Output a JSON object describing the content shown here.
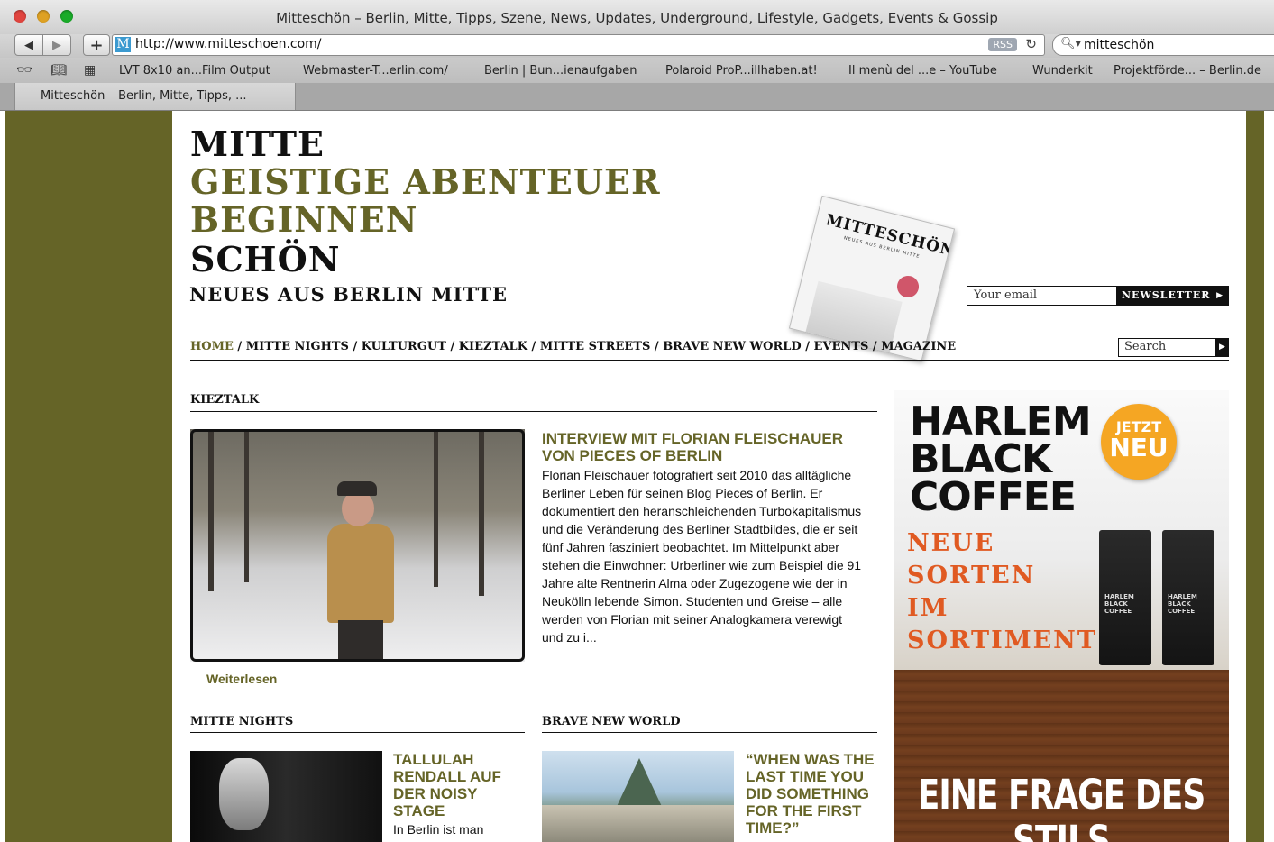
{
  "browser": {
    "window_title": "Mitteschön – Berlin, Mitte, Tipps, Szene, News, Updates, Underground, Lifestyle, Gadgets, Events & Gossip",
    "url": "http://www.mitteschoen.com/",
    "search_query": "mitteschön",
    "rss_label": "RSS",
    "favicon_letter": "M",
    "bookmarks": [
      "LVT 8x10 an...Film Output",
      "Webmaster-T...erlin.com/",
      "Berlin | Bun...ienaufgaben",
      "Polaroid ProP...illhaben.at!",
      "Il menù del ...e – YouTube",
      "Wunderkit",
      "Projektförde... – Berlin.de"
    ],
    "tab_title": "Mitteschön – Berlin, Mitte, Tipps, ..."
  },
  "site": {
    "logo_lines": [
      "MITTE",
      "GEISTIGE ABENTEUER",
      "BEGINNEN",
      "SCHÖN"
    ],
    "subtitle": "NEUES AUS BERLIN MITTE",
    "magazine_title": "MITTESCHÖN",
    "magazine_subtitle": "NEUES AUS BERLIN MITTE",
    "newsletter_placeholder": "Your email",
    "newsletter_button": "NEWSLETTER",
    "nav": [
      "HOME",
      "MITTE NIGHTS",
      "KULTURGUT",
      "KIEZTALK",
      "MITTE STREETS",
      "BRAVE NEW WORLD",
      "EVENTS",
      "MAGAZINE"
    ],
    "search_placeholder": "Search"
  },
  "featured": {
    "section": "KIEZTALK",
    "title": "INTERVIEW MIT FLORIAN FLEISCHAUER VON PIECES OF BERLIN",
    "body": "Florian Fleischauer fotografiert seit 2010 das alltägliche Berliner Leben für seinen Blog Pieces of Berlin. Er dokumentiert den heranschleichenden Turbokapitalismus und die Veränderung des Berliner Stadtbildes, die er seit fünf Jahren fasziniert beobachtet. Im Mittelpunkt aber stehen die Einwohner: Urberliner wie zum Beispiel die 91 Jahre alte Rentnerin Alma oder Zugezogene wie der in Neukölln lebende Simon. Studenten und Greise – alle werden von Florian mit seiner Analogkamera verewigt und zu i...",
    "read_more": "Weiterlesen"
  },
  "teasers": [
    {
      "section": "MITTE NIGHTS",
      "title": "TALLULAH RENDALL AUF DER NOISY STAGE",
      "body": "In Berlin ist man"
    },
    {
      "section": "BRAVE NEW WORLD",
      "title": "“WHEN WAS THE LAST TIME YOU DID SOMETHING FOR THE FIRST TIME?”",
      "body": ""
    }
  ],
  "ad": {
    "headline": [
      "HARLEM",
      "BLACK",
      "COFFEE"
    ],
    "badge": [
      "JETZT",
      "NEU"
    ],
    "tagline": [
      "NEUE",
      "SORTEN",
      "IM",
      "SORTIMENT"
    ],
    "bag_label": "HARLEM BLACK COFFEE",
    "slogan": "EINE FRAGE DES STILS"
  },
  "colors": {
    "olive": "#656427",
    "ad_orange": "#e05a22",
    "badge": "#f5a623"
  }
}
